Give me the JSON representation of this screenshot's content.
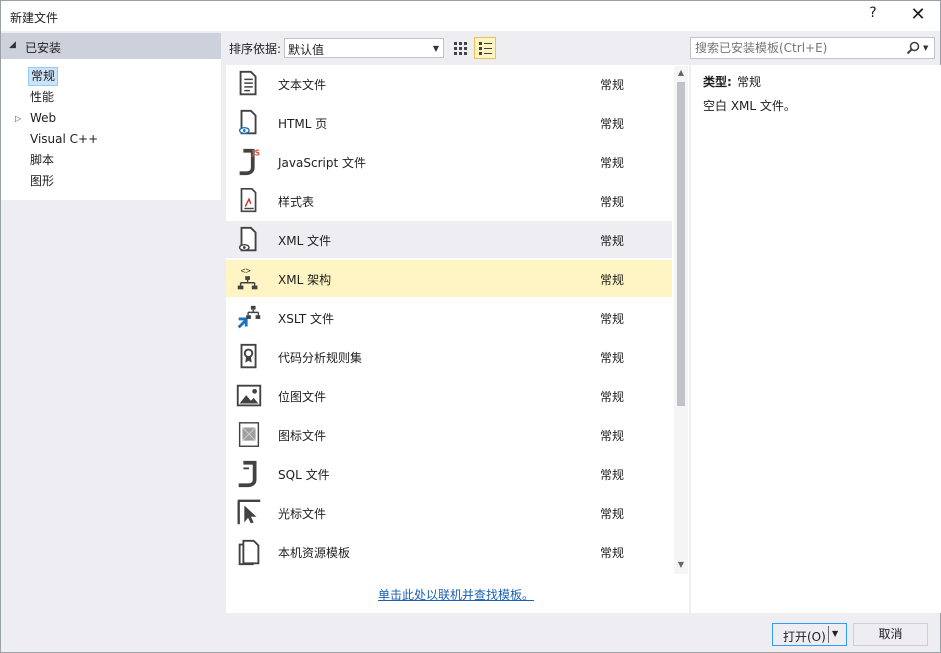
{
  "window": {
    "title": "新建文件",
    "help": "?",
    "close": "✕"
  },
  "sidebar": {
    "header": "已安装",
    "items": [
      {
        "label": "常规",
        "selected": true,
        "expandable": false
      },
      {
        "label": "性能",
        "selected": false,
        "expandable": false
      },
      {
        "label": "Web",
        "selected": false,
        "expandable": true
      },
      {
        "label": "Visual C++",
        "selected": false,
        "expandable": false
      },
      {
        "label": "脚本",
        "selected": false,
        "expandable": false
      },
      {
        "label": "图形",
        "selected": false,
        "expandable": false
      }
    ]
  },
  "toolbar": {
    "sort_label": "排序依据:",
    "sort_value": "默认值",
    "search_placeholder": "搜索已安装模板(Ctrl+E)"
  },
  "templates": [
    {
      "name": "文本文件",
      "category": "常规",
      "icon": "text-file-icon"
    },
    {
      "name": "HTML 页",
      "category": "常规",
      "icon": "html-page-icon"
    },
    {
      "name": "JavaScript 文件",
      "category": "常规",
      "icon": "javascript-file-icon"
    },
    {
      "name": "样式表",
      "category": "常规",
      "icon": "stylesheet-icon"
    },
    {
      "name": "XML 文件",
      "category": "常规",
      "icon": "xml-file-icon"
    },
    {
      "name": "XML 架构",
      "category": "常规",
      "icon": "xml-schema-icon"
    },
    {
      "name": "XSLT 文件",
      "category": "常规",
      "icon": "xslt-file-icon"
    },
    {
      "name": "代码分析规则集",
      "category": "常规",
      "icon": "code-analysis-ruleset-icon"
    },
    {
      "name": "位图文件",
      "category": "常规",
      "icon": "bitmap-file-icon"
    },
    {
      "name": "图标文件",
      "category": "常规",
      "icon": "icon-file-icon"
    },
    {
      "name": "SQL 文件",
      "category": "常规",
      "icon": "sql-file-icon"
    },
    {
      "name": "光标文件",
      "category": "常规",
      "icon": "cursor-file-icon"
    },
    {
      "name": "本机资源模板",
      "category": "常规",
      "icon": "native-resource-template-icon"
    }
  ],
  "hovered_index": 4,
  "selected_index": 5,
  "online_link": "单击此处以联机并查找模板。",
  "details": {
    "type_label": "类型:",
    "type_value": "常规",
    "description": "空白 XML 文件。"
  },
  "buttons": {
    "open": "打开(O)",
    "cancel": "取消"
  },
  "colors": {
    "selection": "#fff4c4",
    "hover": "#eeeef2",
    "tree_selected": "#cce4f7",
    "link": "#1a5fb4",
    "accent": "#3399ff"
  }
}
